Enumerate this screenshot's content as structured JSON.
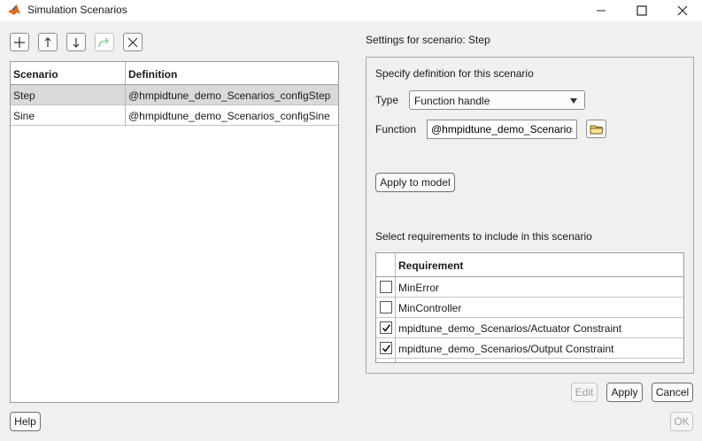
{
  "window": {
    "title": "Simulation Scenarios",
    "icon": "matlab-icon",
    "controls": [
      "minimize-icon",
      "maximize-icon",
      "close-icon"
    ]
  },
  "toolbar": {
    "buttons": [
      {
        "name": "add-scenario-button",
        "icon": "plus-icon"
      },
      {
        "name": "move-up-button",
        "icon": "arrow-up-icon"
      },
      {
        "name": "move-down-button",
        "icon": "arrow-down-icon"
      },
      {
        "name": "redo-button",
        "icon": "redo-arrow-icon",
        "enabled": false
      },
      {
        "name": "delete-scenario-button",
        "icon": "close-icon"
      }
    ]
  },
  "scenarios": {
    "headers": [
      "Scenario",
      "Definition"
    ],
    "rows": [
      {
        "scenario": "Step",
        "definition": "@hmpidtune_demo_Scenarios_configStep",
        "selected": true
      },
      {
        "scenario": "Sine",
        "definition": "@hmpidtune_demo_Scenarios_configSine",
        "selected": false
      }
    ]
  },
  "settings": {
    "title": "Settings for scenario: Step",
    "specify_label": "Specify definition for this scenario",
    "type_label": "Type",
    "type_value": "Function handle",
    "function_label": "Function",
    "function_value": "@hmpidtune_demo_Scenarios",
    "apply_to_model": "Apply to model",
    "requirements_label": "Select requirements to include in this scenario",
    "requirements": {
      "header": "Requirement",
      "rows": [
        {
          "label": "MinError",
          "checked": false
        },
        {
          "label": "MinController",
          "checked": false
        },
        {
          "label": "mpidtune_demo_Scenarios/Actuator Constraint",
          "checked": true
        },
        {
          "label": "mpidtune_demo_Scenarios/Output Constraint",
          "checked": true
        }
      ]
    }
  },
  "buttons": {
    "edit": "Edit",
    "apply": "Apply",
    "cancel": "Cancel",
    "help": "Help",
    "ok": "OK"
  },
  "colors": {
    "background": "#f0f0f0",
    "selected_row": "#d9d9d9",
    "disabled_text": "#a0a0a0",
    "redo_icon": "#3aa855"
  }
}
